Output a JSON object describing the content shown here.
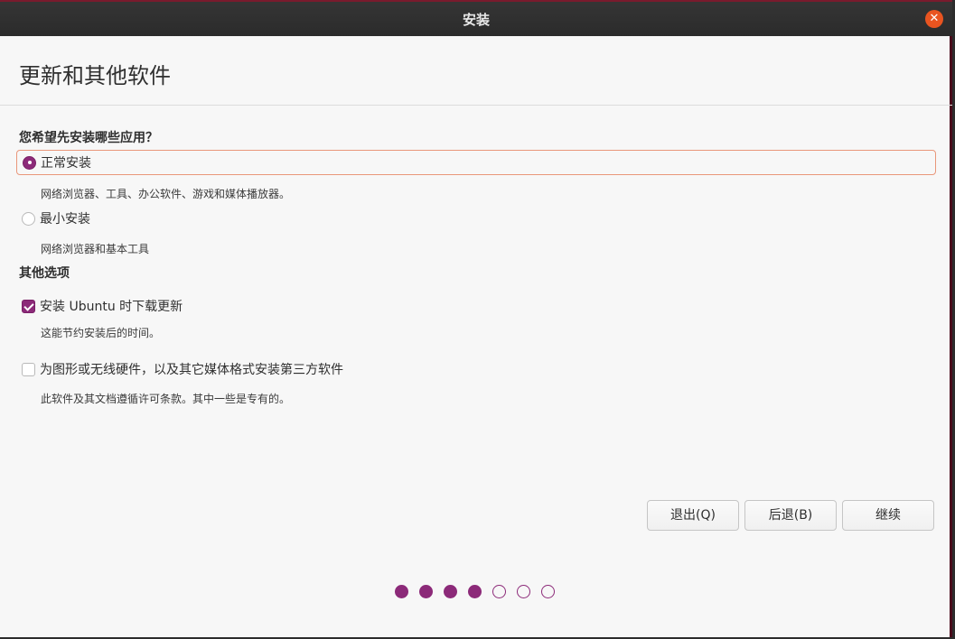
{
  "window": {
    "title": "安装"
  },
  "header": {
    "title": "更新和其他软件"
  },
  "install_type": {
    "question": "您希望先安装哪些应用？",
    "options": [
      {
        "label": "正常安装",
        "description": "网络浏览器、工具、办公软件、游戏和媒体播放器。",
        "selected": true
      },
      {
        "label": "最小安装",
        "description": "网络浏览器和基本工具",
        "selected": false
      }
    ]
  },
  "other_options": {
    "title": "其他选项",
    "items": [
      {
        "label": "安装 Ubuntu 时下载更新",
        "description": "这能节约安装后的时间。",
        "checked": true
      },
      {
        "label": "为图形或无线硬件，以及其它媒体格式安装第三方软件",
        "description": "此软件及其文档遵循许可条款。其中一些是专有的。",
        "checked": false
      }
    ]
  },
  "buttons": {
    "quit": "退出(Q)",
    "back": "后退(B)",
    "continue": "继续"
  },
  "progress": {
    "total_steps": 7,
    "completed_steps": 4
  },
  "colors": {
    "accent": "#8c2a79",
    "close": "#e95420",
    "focus_border": "#e9977a"
  }
}
